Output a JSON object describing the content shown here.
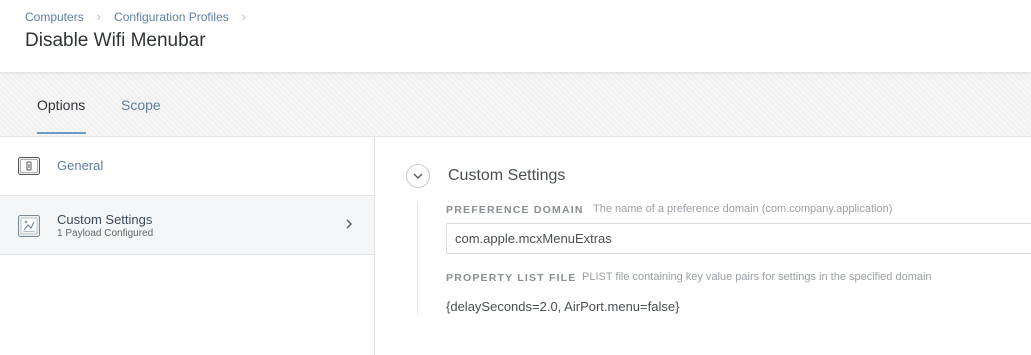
{
  "breadcrumb": [
    "Computers",
    "Configuration Profiles"
  ],
  "page": {
    "title": "Disable Wifi Menubar"
  },
  "tabs": [
    {
      "label": "Options",
      "active": true
    },
    {
      "label": "Scope",
      "active": false
    }
  ],
  "sidebar": {
    "items": [
      {
        "label": "General",
        "icon": "general-switch-icon"
      },
      {
        "label": "Custom Settings",
        "sub": "1 Payload Configured",
        "icon": "custom-settings-icon",
        "selected": true
      }
    ]
  },
  "main": {
    "section_title": "Custom Settings",
    "preference_domain": {
      "label": "PREFERENCE DOMAIN",
      "help": "The name of a preference domain (com.company.application)",
      "value": "com.apple.mcxMenuExtras"
    },
    "property_list": {
      "label": "PROPERTY LIST FILE",
      "help": "PLIST file containing key value pairs for settings in the specified domain",
      "value": "{delaySeconds=2.0, AirPort.menu=false}"
    }
  },
  "colors": {
    "link": "#5e7fa3",
    "tab_underline": "#6b9ac4",
    "selected_bg": "#f4f5f7"
  }
}
